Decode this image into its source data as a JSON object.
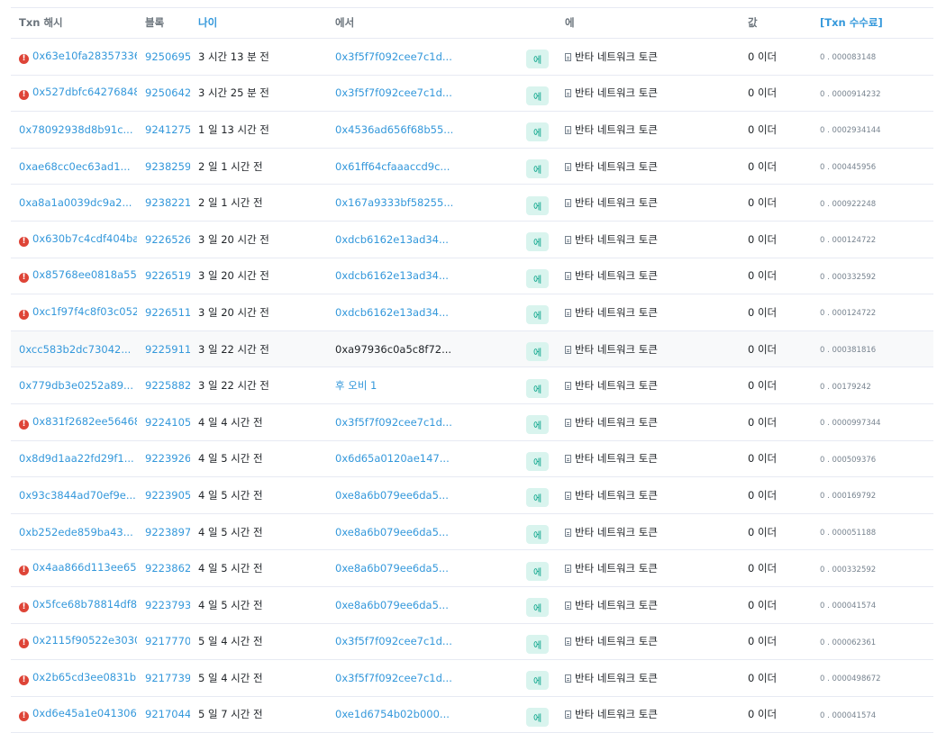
{
  "headers": {
    "txn_hash": "Txn 해시",
    "block": "블록",
    "age": "나이",
    "from": "에서",
    "to": "에",
    "value": "값",
    "fee": "[Txn 수수료]"
  },
  "rows": [
    {
      "error": true,
      "hash": "0x63e10fa28357336...",
      "block": "9250695",
      "age": "3 시간 13 분 전",
      "from": "0x3f5f7f092cee7c1d...",
      "from_link": true,
      "dir": "에",
      "to": "반타 네트워크 토큰",
      "value": "0 이더",
      "fee": "0 . 000083148"
    },
    {
      "error": true,
      "hash": "0x527dbfc64276848...",
      "block": "9250642",
      "age": "3 시간 25 분 전",
      "from": "0x3f5f7f092cee7c1d...",
      "from_link": true,
      "dir": "에",
      "to": "반타 네트워크 토큰",
      "value": "0 이더",
      "fee": "0 . 0000914232"
    },
    {
      "error": false,
      "hash": "0x78092938d8b91c...",
      "block": "9241275",
      "age": "1 일 13 시간 전",
      "from": "0x4536ad656f68b55...",
      "from_link": true,
      "dir": "에",
      "to": "반타 네트워크 토큰",
      "value": "0 이더",
      "fee": "0 . 0002934144"
    },
    {
      "error": false,
      "hash": "0xae68cc0ec63ad1...",
      "block": "9238259",
      "age": "2 일 1 시간 전",
      "from": "0x61ff64cfaaaccd9c...",
      "from_link": true,
      "dir": "에",
      "to": "반타 네트워크 토큰",
      "value": "0 이더",
      "fee": "0 . 000445956"
    },
    {
      "error": false,
      "hash": "0xa8a1a0039dc9a2...",
      "block": "9238221",
      "age": "2 일 1 시간 전",
      "from": "0x167a9333bf58255...",
      "from_link": true,
      "dir": "에",
      "to": "반타 네트워크 토큰",
      "value": "0 이더",
      "fee": "0 . 000922248"
    },
    {
      "error": true,
      "hash": "0x630b7c4cdf404ba...",
      "block": "9226526",
      "age": "3 일 20 시간 전",
      "from": "0xdcb6162e13ad34...",
      "from_link": true,
      "dir": "에",
      "to": "반타 네트워크 토큰",
      "value": "0 이더",
      "fee": "0 . 000124722"
    },
    {
      "error": true,
      "hash": "0x85768ee0818a55...",
      "block": "9226519",
      "age": "3 일 20 시간 전",
      "from": "0xdcb6162e13ad34...",
      "from_link": true,
      "dir": "에",
      "to": "반타 네트워크 토큰",
      "value": "0 이더",
      "fee": "0 . 000332592"
    },
    {
      "error": true,
      "hash": "0xc1f97f4c8f03c052...",
      "block": "9226511",
      "age": "3 일 20 시간 전",
      "from": "0xdcb6162e13ad34...",
      "from_link": true,
      "dir": "에",
      "to": "반타 네트워크 토큰",
      "value": "0 이더",
      "fee": "0 . 000124722"
    },
    {
      "error": false,
      "hash": "0xcc583b2dc73042...",
      "block": "9225911",
      "age": "3 일 22 시간 전",
      "from": "0xa97936c0a5c8f72...",
      "from_link": false,
      "dir": "에",
      "to": "반타 네트워크 토큰",
      "value": "0 이더",
      "fee": "0 . 000381816"
    },
    {
      "error": false,
      "hash": "0x779db3e0252a89...",
      "block": "9225882",
      "age": "3 일 22 시간 전",
      "from": "후 오비 1",
      "from_link": true,
      "dir": "에",
      "to": "반타 네트워크 토큰",
      "value": "0 이더",
      "fee": "0 . 00179242"
    },
    {
      "error": true,
      "hash": "0x831f2682ee56468...",
      "block": "9224105",
      "age": "4 일 4 시간 전",
      "from": "0x3f5f7f092cee7c1d...",
      "from_link": true,
      "dir": "에",
      "to": "반타 네트워크 토큰",
      "value": "0 이더",
      "fee": "0 . 0000997344"
    },
    {
      "error": false,
      "hash": "0x8d9d1aa22fd29f1...",
      "block": "9223926",
      "age": "4 일 5 시간 전",
      "from": "0x6d65a0120ae147...",
      "from_link": true,
      "dir": "에",
      "to": "반타 네트워크 토큰",
      "value": "0 이더",
      "fee": "0 . 000509376"
    },
    {
      "error": false,
      "hash": "0x93c3844ad70ef9e...",
      "block": "9223905",
      "age": "4 일 5 시간 전",
      "from": "0xe8a6b079ee6da5...",
      "from_link": true,
      "dir": "에",
      "to": "반타 네트워크 토큰",
      "value": "0 이더",
      "fee": "0 . 000169792"
    },
    {
      "error": false,
      "hash": "0xb252ede859ba43...",
      "block": "9223897",
      "age": "4 일 5 시간 전",
      "from": "0xe8a6b079ee6da5...",
      "from_link": true,
      "dir": "에",
      "to": "반타 네트워크 토큰",
      "value": "0 이더",
      "fee": "0 . 000051188"
    },
    {
      "error": true,
      "hash": "0x4aa866d113ee65...",
      "block": "9223862",
      "age": "4 일 5 시간 전",
      "from": "0xe8a6b079ee6da5...",
      "from_link": true,
      "dir": "에",
      "to": "반타 네트워크 토큰",
      "value": "0 이더",
      "fee": "0 . 000332592"
    },
    {
      "error": true,
      "hash": "0x5fce68b78814df8...",
      "block": "9223793",
      "age": "4 일 5 시간 전",
      "from": "0xe8a6b079ee6da5...",
      "from_link": true,
      "dir": "에",
      "to": "반타 네트워크 토큰",
      "value": "0 이더",
      "fee": "0 . 000041574"
    },
    {
      "error": true,
      "hash": "0x2115f90522e3030...",
      "block": "9217770",
      "age": "5 일 4 시간 전",
      "from": "0x3f5f7f092cee7c1d...",
      "from_link": true,
      "dir": "에",
      "to": "반타 네트워크 토큰",
      "value": "0 이더",
      "fee": "0 . 000062361"
    },
    {
      "error": true,
      "hash": "0x2b65cd3ee0831b...",
      "block": "9217739",
      "age": "5 일 4 시간 전",
      "from": "0x3f5f7f092cee7c1d...",
      "from_link": true,
      "dir": "에",
      "to": "반타 네트워크 토큰",
      "value": "0 이더",
      "fee": "0 . 0000498672"
    },
    {
      "error": true,
      "hash": "0xd6e45a1e041306...",
      "block": "9217044",
      "age": "5 일 7 시간 전",
      "from": "0xe1d6754b02b000...",
      "from_link": true,
      "dir": "에",
      "to": "반타 네트워크 토큰",
      "value": "0 이더",
      "fee": "0 . 000041574"
    }
  ]
}
